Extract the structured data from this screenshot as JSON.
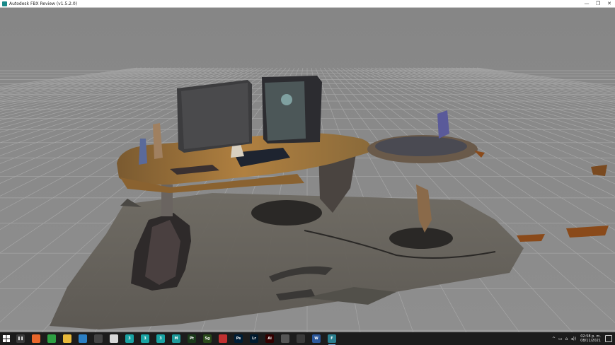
{
  "window": {
    "title": "Autodesk FBX Review (v1.5.2.0)",
    "minimize_label": "—",
    "restore_label": "❐",
    "close_label": "✕"
  },
  "taskbar": {
    "apps": [
      {
        "name": "task-view",
        "glyph": "❚❚",
        "color": "#3a3a3a"
      },
      {
        "name": "firefox",
        "glyph": "",
        "color": "#e8662a"
      },
      {
        "name": "chrome",
        "glyph": "",
        "color": "#2ea043"
      },
      {
        "name": "file-explorer",
        "glyph": "",
        "color": "#e8b93a"
      },
      {
        "name": "app-blue-1",
        "glyph": "",
        "color": "#2b7fc4"
      },
      {
        "name": "app-terminal",
        "glyph": "",
        "color": "#444"
      },
      {
        "name": "app-cube",
        "glyph": "",
        "color": "#d8d8d8"
      },
      {
        "name": "app-3ds-1",
        "glyph": "3",
        "color": "#19a3a3"
      },
      {
        "name": "app-3ds-2",
        "glyph": "3",
        "color": "#19a3a3"
      },
      {
        "name": "app-3ds-3",
        "glyph": "3",
        "color": "#19a3a3"
      },
      {
        "name": "app-maya",
        "glyph": "M",
        "color": "#1d9a9a"
      },
      {
        "name": "app-painter",
        "glyph": "Pt",
        "color": "#1a3a1a"
      },
      {
        "name": "app-designer",
        "glyph": "Sg",
        "color": "#2a4a1a"
      },
      {
        "name": "app-red-circle",
        "glyph": "",
        "color": "#c03030"
      },
      {
        "name": "app-photoshop",
        "glyph": "Ps",
        "color": "#001e36"
      },
      {
        "name": "app-lightroom",
        "glyph": "Lr",
        "color": "#001a2e"
      },
      {
        "name": "app-illustrator",
        "glyph": "Ai",
        "color": "#330000"
      },
      {
        "name": "app-wacom",
        "glyph": "",
        "color": "#555"
      },
      {
        "name": "app-store",
        "glyph": "",
        "color": "#3a3a3a"
      },
      {
        "name": "app-word",
        "glyph": "W",
        "color": "#2b579a"
      },
      {
        "name": "app-fbx",
        "glyph": "F",
        "color": "#2a7f8f"
      }
    ],
    "tray": {
      "chevron": "^",
      "icons": [
        "▭",
        "⌂",
        "◂))"
      ],
      "time": "02:58 p. m.",
      "date": "08/11/2021"
    }
  }
}
